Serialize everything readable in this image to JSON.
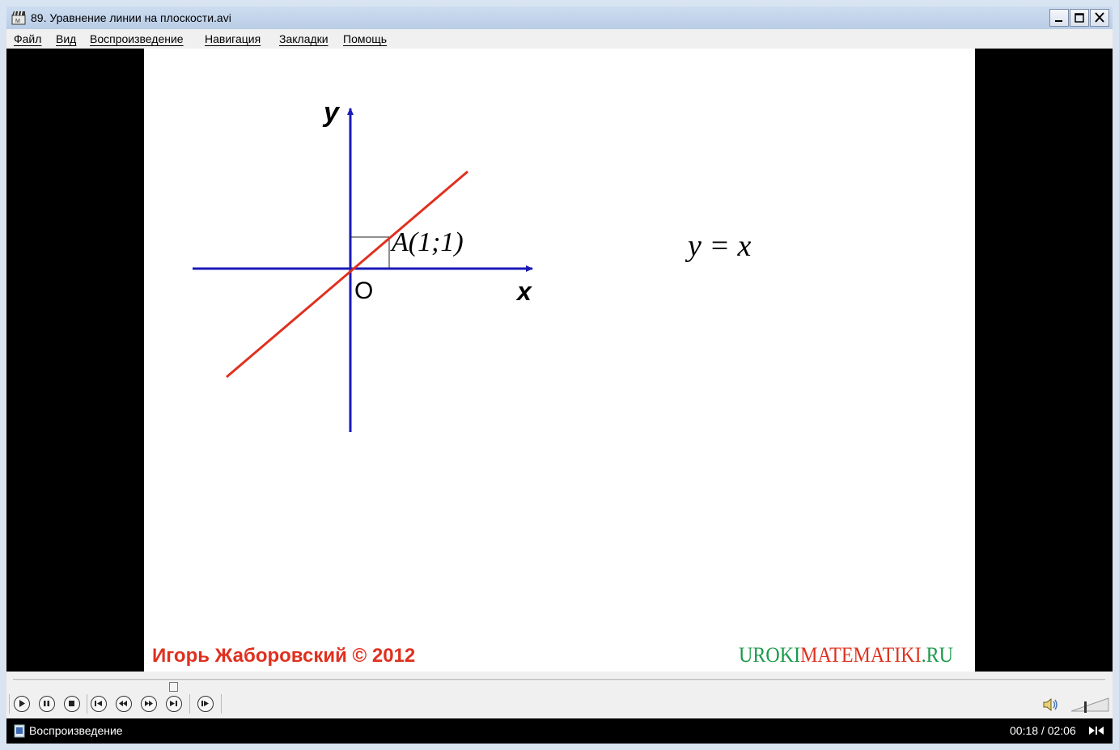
{
  "window": {
    "title": "89. Уравнение линии на плоскости.avi",
    "controls": [
      "minimize",
      "maximize",
      "close"
    ]
  },
  "menu": {
    "items": [
      "Файл",
      "Вид",
      "Воспроизведение",
      "Навигация",
      "Закладки",
      "Помощь"
    ]
  },
  "video": {
    "axis_y_label": "y",
    "axis_x_label": "x",
    "origin_label": "O",
    "point_label": "A(1;1)",
    "equation": "y = x",
    "author": "Игорь Жаборовский © 2012",
    "site_part1": "UROKI",
    "site_part2": "MATEMATIKI",
    "site_part3": ".RU",
    "colors": {
      "axis": "#1a1ab8",
      "line": "#e0301e",
      "author": "#e0301e",
      "site_green": "#1a9a4a",
      "site_red": "#e0301e"
    }
  },
  "playback": {
    "progress_fraction": 0.143,
    "buttons": [
      "play-icon",
      "pause-icon",
      "stop-icon",
      "skip-back-icon",
      "rewind-icon",
      "fast-forward-icon",
      "skip-forward-icon",
      "frame-step-icon"
    ],
    "volume_icon": "speaker-icon"
  },
  "status": {
    "text": "Воспроизведение",
    "time": "00:18 / 02:06"
  }
}
